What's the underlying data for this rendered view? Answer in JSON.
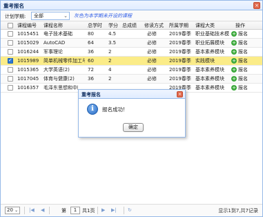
{
  "window": {
    "title": "重考报名",
    "close_glyph": "×"
  },
  "filter": {
    "label": "计划学期:",
    "selected": "全部",
    "hint": "灰色为本学期未开设的课程"
  },
  "columns": [
    "课程编号",
    "课程名称",
    "总学时",
    "学分",
    "总成绩",
    "修读方式",
    "所属学期",
    "课程大类",
    "操作"
  ],
  "rows": [
    {
      "code": "1015451",
      "name": "电子技术基础",
      "hours": "80",
      "credit": "4.5",
      "score": "",
      "mode": "必修",
      "term": "2019春季",
      "category": "职业基础技术模",
      "action": "报名",
      "checked": false
    },
    {
      "code": "1015029",
      "name": "AutoCAD",
      "hours": "64",
      "credit": "3.5",
      "score": "",
      "mode": "必修",
      "term": "2019春季",
      "category": "职业拓展模块",
      "action": "报名",
      "checked": false
    },
    {
      "code": "1016244",
      "name": "军事理论",
      "hours": "36",
      "credit": "2",
      "score": "",
      "mode": "必修",
      "term": "2019春季",
      "category": "基本素养模块",
      "action": "报名",
      "checked": false
    },
    {
      "code": "1015989",
      "name": "简单机械零件加工与装",
      "hours": "60",
      "credit": "2",
      "score": "",
      "mode": "必修",
      "term": "2019春季",
      "category": "实践模块",
      "action": "报名",
      "checked": true
    },
    {
      "code": "1015365",
      "name": "大学英语(2)",
      "hours": "72",
      "credit": "4",
      "score": "",
      "mode": "必修",
      "term": "2019春季",
      "category": "基本素养模块",
      "action": "报名",
      "checked": false
    },
    {
      "code": "1017045",
      "name": "体育与健康(2)",
      "hours": "36",
      "credit": "2",
      "score": "",
      "mode": "必修",
      "term": "2019春季",
      "category": "基本素养模块",
      "action": "报名",
      "checked": false
    },
    {
      "code": "1016357",
      "name": "毛泽东思想和中国特",
      "hours": "",
      "credit": "",
      "score": "",
      "mode": "",
      "term": "2019春季",
      "category": "基本素养模块",
      "action": "报名",
      "checked": false
    }
  ],
  "pager": {
    "page_size": "20",
    "page_prefix": "第",
    "page": "1",
    "page_suffix": "共1页",
    "info": "显示1到7,共7记录"
  },
  "dialog": {
    "title": "重考报名",
    "message": "报名成功!",
    "ok_label": "确定",
    "close_glyph": "×"
  }
}
